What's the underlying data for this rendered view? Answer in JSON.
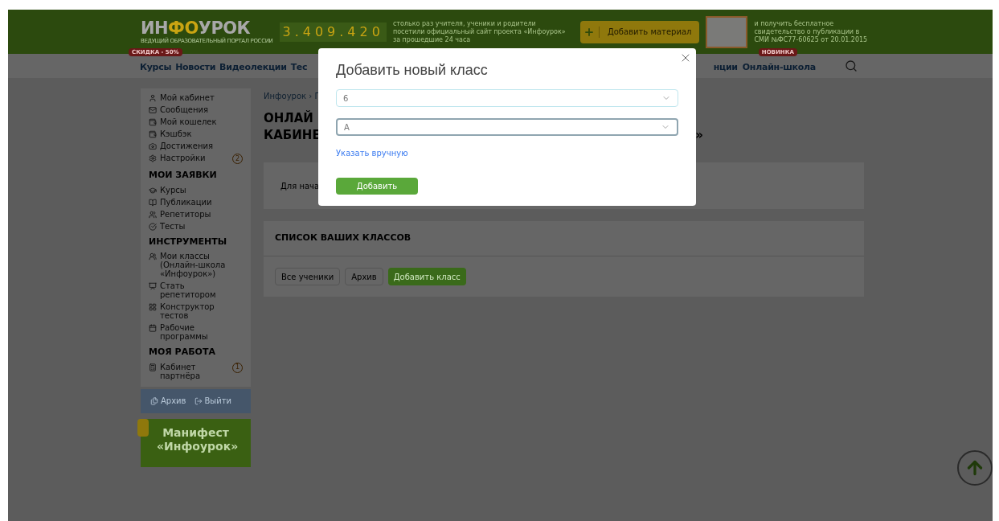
{
  "header": {
    "logo": {
      "segments": [
        {
          "text": "ИН",
          "highlight": false
        },
        {
          "text": "ФО",
          "highlight": true
        },
        {
          "text": "УРОК",
          "highlight": false
        }
      ],
      "tagline": "ВЕДУЩИЙ ОБРАЗОВАТЕЛЬНЫЙ ПОРТАЛ РОССИИ"
    },
    "counter": "3.409.420",
    "counter_caption": "столько раз учителя, ученики и родители посетили официальный сайт проекта «Инфоурок» за прошедшие 24 часа",
    "add_button": {
      "label": "Добавить материал"
    },
    "certificate_caption": "и получить бесплатное свидетельство о публикации в СМИ №ФС77-60625 от 20.01.2015"
  },
  "nav": {
    "items": [
      {
        "label": "Курсы",
        "badge": "СКИДКА - 50%"
      },
      {
        "label": "Новости"
      },
      {
        "label": "Видеолекции"
      },
      {
        "label": "Тес"
      }
    ],
    "items_right": [
      {
        "label": "нции"
      },
      {
        "label": "Онлайн-школа",
        "badge": "НОВИНКА"
      }
    ]
  },
  "sidebar": {
    "items": [
      {
        "kind": "item",
        "label": "Мой кабинет"
      },
      {
        "kind": "item",
        "label": "Сообщения"
      },
      {
        "kind": "item",
        "label": "Мой кошелек"
      },
      {
        "kind": "item",
        "label": "Кэшбэк"
      },
      {
        "kind": "item",
        "label": "Достижения"
      },
      {
        "kind": "item",
        "label": "Настройки",
        "count": "2"
      },
      {
        "kind": "heading",
        "label": "МОИ ЗАЯВКИ"
      },
      {
        "kind": "item",
        "label": "Курсы"
      },
      {
        "kind": "item",
        "label": "Публикации"
      },
      {
        "kind": "item",
        "label": "Репетиторы"
      },
      {
        "kind": "item",
        "label": "Тесты"
      },
      {
        "kind": "heading",
        "label": "ИНСТРУМЕНТЫ"
      },
      {
        "kind": "item",
        "label": "Мои классы (Онлайн-школа «Инфоурок»)"
      },
      {
        "kind": "item",
        "label": "Стать репетитором"
      },
      {
        "kind": "item",
        "label": "Конструктор тестов"
      },
      {
        "kind": "item",
        "label": "Рабочие программы"
      },
      {
        "kind": "heading",
        "label": "МОЯ РАБОТА"
      },
      {
        "kind": "item",
        "label": "Кабинет партнёра",
        "count": "1"
      }
    ],
    "footer": [
      {
        "label": "Архив"
      },
      {
        "label": "Выйти"
      }
    ],
    "promo": "Манифест «Инфоурок»"
  },
  "main": {
    "breadcrumb": "Инфоурок › Г",
    "title_line1": "ОНЛАЙ",
    "title_line2": "КАБИНЕ",
    "title_tail": "»",
    "intro": "Для нача",
    "classes": {
      "title": "СПИСОК ВАШИХ КЛАССОВ",
      "buttons": [
        {
          "label": "Все ученики",
          "kind": "plain"
        },
        {
          "label": "Архив",
          "kind": "plain"
        },
        {
          "label": "Добавить класс",
          "kind": "primary"
        }
      ]
    }
  },
  "modal": {
    "title": "Добавить новый класс",
    "selects": [
      {
        "value": "6",
        "focused": false
      },
      {
        "value": "А",
        "focused": true
      }
    ],
    "link": "Указать вручную",
    "submit": "Добавить"
  }
}
